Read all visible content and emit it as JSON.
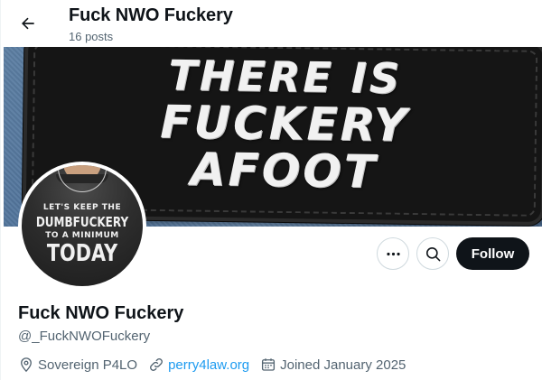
{
  "header": {
    "title": "Fuck NWO Fuckery",
    "posts_count": "16 posts",
    "back_icon": "arrow-left-icon"
  },
  "banner": {
    "line1": "THERE IS",
    "line2": "FUCKERY",
    "line3": "AFOOT"
  },
  "avatar": {
    "line1": "LET'S KEEP THE",
    "line2": "DUMBFUCKERY",
    "line3": "TO A MINIMUM",
    "line4": "TODAY"
  },
  "actions": {
    "more_icon": "more-horizontal-icon",
    "search_icon": "search-icon",
    "follow_label": "Follow"
  },
  "profile": {
    "display_name": "Fuck NWO Fuckery",
    "handle": "@_FuckNWOFuckery",
    "location": "Sovereign P4LO",
    "website": "perry4law.org",
    "joined": "Joined January 2025"
  },
  "colors": {
    "accent": "#1d9bf0",
    "text_primary": "#0f1419",
    "text_secondary": "#536471",
    "button_dark": "#0f1419"
  }
}
